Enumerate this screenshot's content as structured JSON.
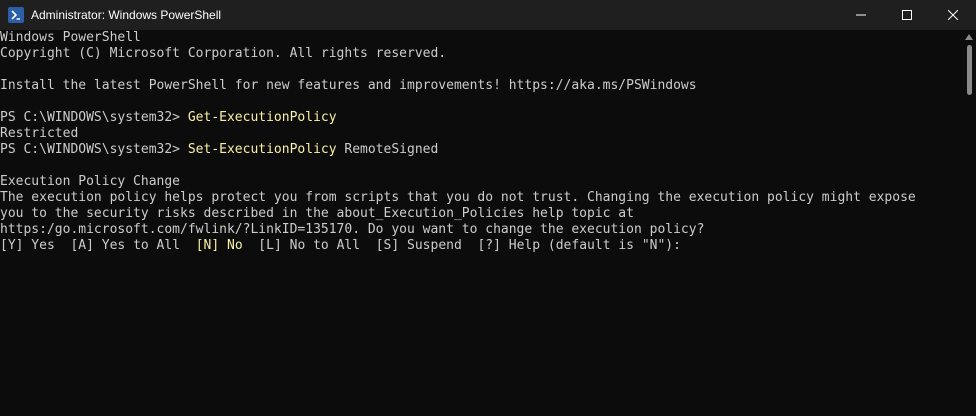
{
  "window": {
    "title": "Administrator: Windows PowerShell",
    "icon": "powershell-icon",
    "controls": [
      "minimize-icon",
      "maximize-icon",
      "close-icon"
    ]
  },
  "console": {
    "line1": "Windows PowerShell",
    "line2": "Copyright (C) Microsoft Corporation. All rights reserved.",
    "line4": "Install the latest PowerShell for new features and improvements! https://aka.ms/PSWindows",
    "prompt1": "PS C:\\WINDOWS\\system32> ",
    "command1": "Get-ExecutionPolicy",
    "output1": "Restricted",
    "prompt2": "PS C:\\WINDOWS\\system32> ",
    "command2": "Set-ExecutionPolicy",
    "command2_arg": " RemoteSigned",
    "heading": "Execution Policy Change",
    "message1": "The execution policy helps protect you from scripts that you do not trust. Changing the execution policy might expose",
    "message2": "you to the security risks described in the about_Execution_Policies help topic at",
    "message3": "https:/go.microsoft.com/fwlink/?LinkID=135170. Do you want to change the execution policy?",
    "choice_yes": "[Y] Yes  ",
    "choice_yes_all": "[A] Yes to All  ",
    "choice_no": "[N] No",
    "choice_no_all": "  [L] No to All  ",
    "choice_suspend": "[S] Suspend  ",
    "choice_help": "[?] Help (default is \"N\"): "
  },
  "colors": {
    "background": "#0c0c0c",
    "text": "#cccccc",
    "command": "#f9f1a5",
    "titlebar": "#1f1f1f"
  }
}
